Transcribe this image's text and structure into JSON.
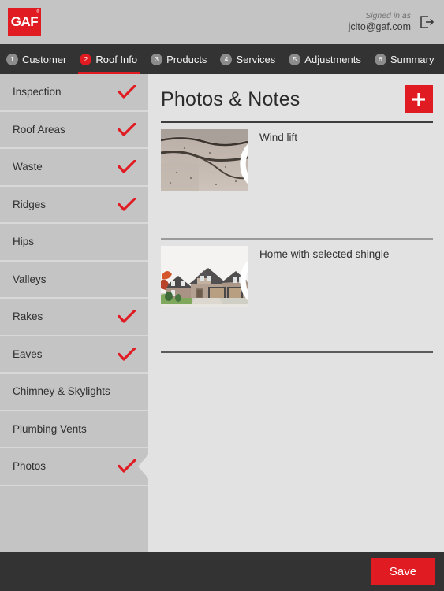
{
  "header": {
    "logo_text": "GAF",
    "logo_registered": "®",
    "signed_in_label": "Signed in as",
    "user_email": "jcito@gaf.com",
    "signout_icon": "sign-out-arrow-icon"
  },
  "stepnav": {
    "steps": [
      {
        "num": "1",
        "label": "Customer",
        "active": false
      },
      {
        "num": "2",
        "label": "Roof Info",
        "active": true
      },
      {
        "num": "3",
        "label": "Products",
        "active": false
      },
      {
        "num": "4",
        "label": "Services",
        "active": false
      },
      {
        "num": "5",
        "label": "Adjustments",
        "active": false
      },
      {
        "num": "6",
        "label": "Summary",
        "active": false
      }
    ]
  },
  "sidebar": {
    "items": [
      {
        "label": "Inspection",
        "checked": true,
        "selected": false
      },
      {
        "label": "Roof Areas",
        "checked": true,
        "selected": false
      },
      {
        "label": "Waste",
        "checked": true,
        "selected": false
      },
      {
        "label": "Ridges",
        "checked": true,
        "selected": false
      },
      {
        "label": "Hips",
        "checked": false,
        "selected": false
      },
      {
        "label": "Valleys",
        "checked": false,
        "selected": false
      },
      {
        "label": "Rakes",
        "checked": true,
        "selected": false
      },
      {
        "label": "Eaves",
        "checked": true,
        "selected": false
      },
      {
        "label": "Chimney & Skylights",
        "checked": false,
        "selected": false
      },
      {
        "label": "Plumbing Vents",
        "checked": false,
        "selected": false
      },
      {
        "label": "Photos",
        "checked": true,
        "selected": true
      }
    ]
  },
  "main": {
    "title": "Photos & Notes",
    "add_button_icon": "plus-icon",
    "photos": [
      {
        "caption": "Wind lift",
        "image": "shingle-wind-lift-photo",
        "delete_icon": "close-circle-icon"
      },
      {
        "caption": "Home with selected shingle",
        "image": "house-exterior-photo",
        "delete_icon": "close-circle-icon"
      }
    ]
  },
  "footer": {
    "save_label": "Save"
  },
  "colors": {
    "brand_red": "#e01b22",
    "nav_dark": "#333333",
    "header_gray": "#c4c4c4",
    "panel_gray": "#e2e2e2"
  }
}
